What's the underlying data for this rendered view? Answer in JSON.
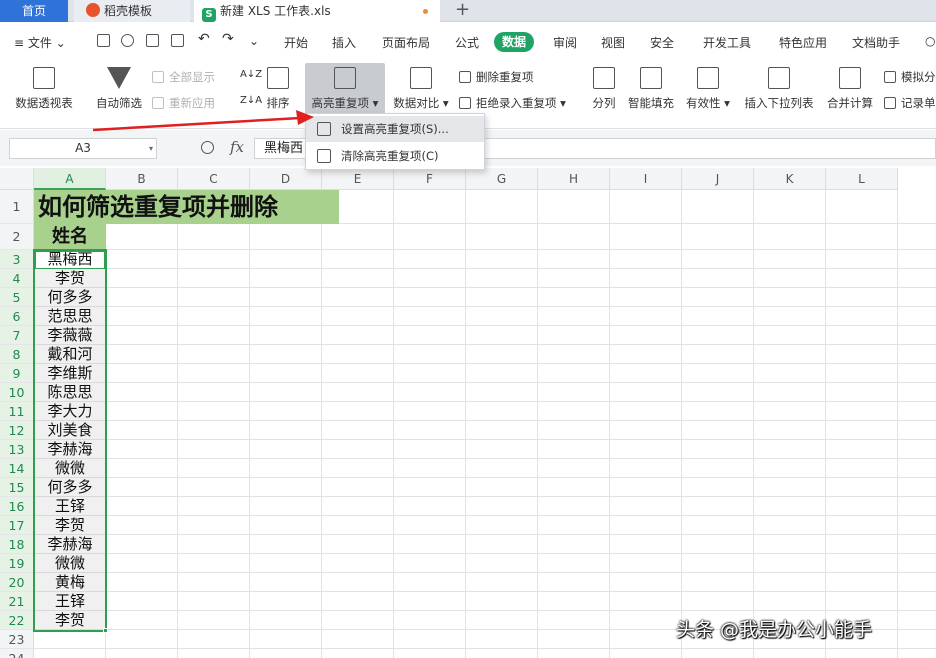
{
  "tabs": {
    "home": "首页",
    "template": "稻壳模板",
    "file": "新建 XLS 工作表.xls",
    "xls_badge": "S",
    "new_tab": "+"
  },
  "menubar": {
    "file_menu": "文件",
    "items": [
      "开始",
      "插入",
      "页面布局",
      "公式",
      "数据",
      "审阅",
      "视图",
      "安全",
      "开发工具",
      "特色应用",
      "文档助手"
    ],
    "active": "数据"
  },
  "ribbon": {
    "pivot": "数据透视表",
    "autofilter": "自动筛选",
    "show_all": "全部显示",
    "reapply": "重新应用",
    "sort": "排序",
    "highlight_dup": "高亮重复项",
    "compare": "数据对比",
    "delete_dup": "删除重复项",
    "reject_dup": "拒绝录入重复项",
    "split": "分列",
    "smart_fill": "智能填充",
    "validity": "有效性",
    "insert_dropdown": "插入下拉列表",
    "consolidate": "合并计算",
    "simulate": "模拟分",
    "record": "记录单"
  },
  "dropdown": {
    "set_highlight": "设置高亮重复项(S)...",
    "clear_highlight": "清除高亮重复项(C)"
  },
  "formula_bar": {
    "name_box": "A3",
    "fx": "fx",
    "value": "黑梅西"
  },
  "sheet": {
    "columns": [
      "A",
      "B",
      "C",
      "D",
      "E",
      "F",
      "G",
      "H",
      "I",
      "J",
      "K",
      "L"
    ],
    "rows": [
      "1",
      "2",
      "3",
      "4",
      "5",
      "6",
      "7",
      "8",
      "9",
      "10",
      "11",
      "12",
      "13",
      "14",
      "15",
      "16",
      "17",
      "18",
      "19",
      "20",
      "21",
      "22",
      "23",
      "24"
    ],
    "title": "如何筛选重复项并删除",
    "header": "姓名",
    "names": [
      "黑梅西",
      "李贺",
      "何多多",
      "范思思",
      "李薇薇",
      "戴和河",
      "李维斯",
      "陈思思",
      "李大力",
      "刘美食",
      "李赫海",
      "微微",
      "何多多",
      "王铎",
      "李贺",
      "李赫海",
      "微微",
      "黄梅",
      "王铎",
      "李贺"
    ]
  },
  "watermark": "头条 @我是办公小能手",
  "colors": {
    "accent_green": "#1fa463",
    "header_fill": "#a9d18e",
    "selection_border": "#2e9e4f",
    "arrow_red": "#e02020",
    "home_tab_blue": "#2f73d9"
  }
}
